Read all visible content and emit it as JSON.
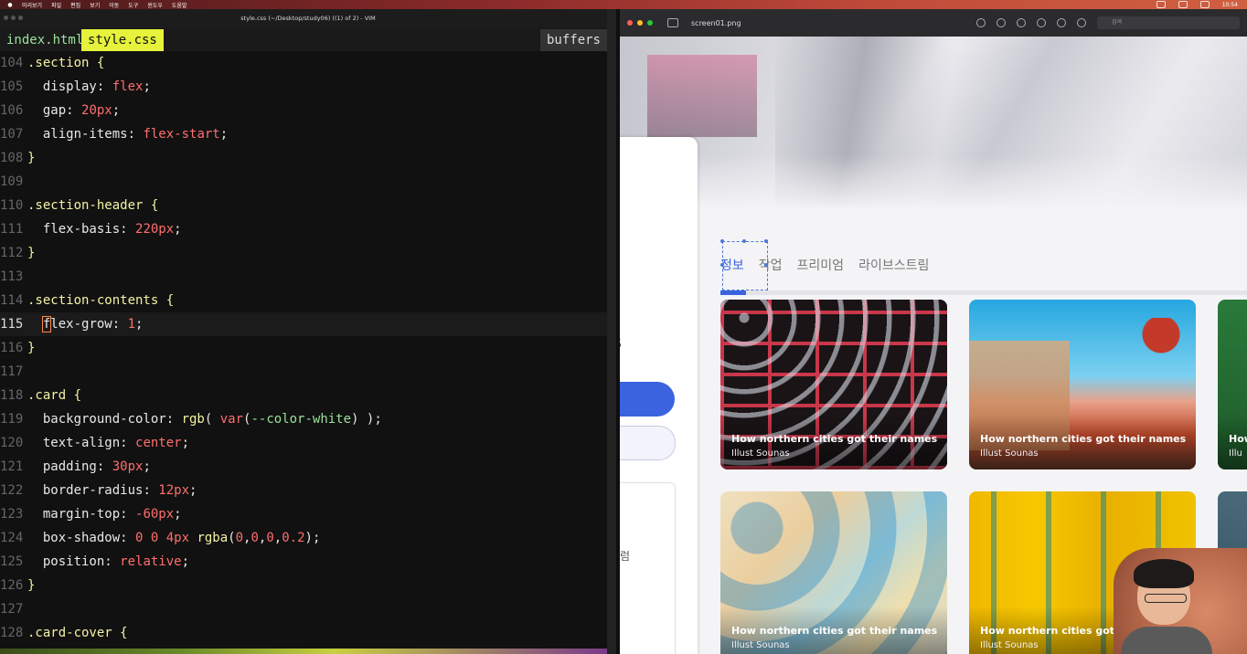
{
  "menubar": {
    "items": [
      "미리보기",
      "파일",
      "편집",
      "보기",
      "이동",
      "도구",
      "윈도우",
      "도움말"
    ],
    "clock": "10:54"
  },
  "vim": {
    "window_title": "style.css (~/Desktop/study06) ((1) of 2) - VIM",
    "tabs": [
      "index.html",
      "style.css"
    ],
    "buffers_label": "buffers",
    "lines": [
      {
        "n": "104",
        "tokens": [
          [
            "sel",
            ".section {"
          ]
        ]
      },
      {
        "n": "105",
        "tokens": [
          [
            "prop",
            "  display"
          ],
          [
            "punct",
            ": "
          ],
          [
            "val",
            "flex"
          ],
          [
            "punct",
            ";"
          ]
        ]
      },
      {
        "n": "106",
        "tokens": [
          [
            "prop",
            "  gap"
          ],
          [
            "punct",
            ": "
          ],
          [
            "num",
            "20px"
          ],
          [
            "punct",
            ";"
          ]
        ]
      },
      {
        "n": "107",
        "tokens": [
          [
            "prop",
            "  align-items"
          ],
          [
            "punct",
            ": "
          ],
          [
            "val",
            "flex-start"
          ],
          [
            "punct",
            ";"
          ]
        ]
      },
      {
        "n": "108",
        "tokens": [
          [
            "sel",
            "}"
          ]
        ]
      },
      {
        "n": "109",
        "tokens": []
      },
      {
        "n": "110",
        "tokens": [
          [
            "sel",
            ".section-header {"
          ]
        ]
      },
      {
        "n": "111",
        "tokens": [
          [
            "prop",
            "  flex-basis"
          ],
          [
            "punct",
            ": "
          ],
          [
            "num",
            "220px"
          ],
          [
            "punct",
            ";"
          ]
        ]
      },
      {
        "n": "112",
        "tokens": [
          [
            "sel",
            "}"
          ]
        ]
      },
      {
        "n": "113",
        "tokens": []
      },
      {
        "n": "114",
        "tokens": [
          [
            "sel",
            ".section-contents {"
          ]
        ]
      },
      {
        "n": "115",
        "tokens": [
          [
            "prop",
            "  flex-grow"
          ],
          [
            "punct",
            ": "
          ],
          [
            "num",
            "1"
          ],
          [
            "punct",
            ";"
          ]
        ],
        "cursor": true
      },
      {
        "n": "116",
        "tokens": [
          [
            "sel",
            "}"
          ]
        ]
      },
      {
        "n": "117",
        "tokens": []
      },
      {
        "n": "118",
        "tokens": [
          [
            "sel",
            ".card {"
          ]
        ]
      },
      {
        "n": "119",
        "tokens": [
          [
            "prop",
            "  background-color"
          ],
          [
            "punct",
            ": "
          ],
          [
            "fn",
            "rgb"
          ],
          [
            "punct",
            "( "
          ],
          [
            "val",
            "var"
          ],
          [
            "punct",
            "("
          ],
          [
            "var",
            "--color-white"
          ],
          [
            "punct",
            ") );"
          ]
        ]
      },
      {
        "n": "120",
        "tokens": [
          [
            "prop",
            "  text-align"
          ],
          [
            "punct",
            ": "
          ],
          [
            "val",
            "center"
          ],
          [
            "punct",
            ";"
          ]
        ]
      },
      {
        "n": "121",
        "tokens": [
          [
            "prop",
            "  padding"
          ],
          [
            "punct",
            ": "
          ],
          [
            "num",
            "30px"
          ],
          [
            "punct",
            ";"
          ]
        ]
      },
      {
        "n": "122",
        "tokens": [
          [
            "prop",
            "  border-radius"
          ],
          [
            "punct",
            ": "
          ],
          [
            "num",
            "12px"
          ],
          [
            "punct",
            ";"
          ]
        ]
      },
      {
        "n": "123",
        "tokens": [
          [
            "prop",
            "  margin-top"
          ],
          [
            "punct",
            ": "
          ],
          [
            "num",
            "-60px"
          ],
          [
            "punct",
            ";"
          ]
        ]
      },
      {
        "n": "124",
        "tokens": [
          [
            "prop",
            "  box-shadow"
          ],
          [
            "punct",
            ": "
          ],
          [
            "num",
            "0 0 4px "
          ],
          [
            "fn",
            "rgba"
          ],
          [
            "punct",
            "("
          ],
          [
            "num",
            "0"
          ],
          [
            "punct",
            ","
          ],
          [
            "num",
            "0"
          ],
          [
            "punct",
            ","
          ],
          [
            "num",
            "0"
          ],
          [
            "punct",
            ","
          ],
          [
            "num",
            "0.2"
          ],
          [
            "punct",
            ");"
          ]
        ]
      },
      {
        "n": "125",
        "tokens": [
          [
            "prop",
            "  position"
          ],
          [
            "punct",
            ": "
          ],
          [
            "val",
            "relative"
          ],
          [
            "punct",
            ";"
          ]
        ]
      },
      {
        "n": "126",
        "tokens": [
          [
            "sel",
            "}"
          ]
        ]
      },
      {
        "n": "127",
        "tokens": []
      },
      {
        "n": "128",
        "tokens": [
          [
            "sel",
            ".card-cover {"
          ]
        ]
      }
    ]
  },
  "preview": {
    "file_name": "screen01.png",
    "search_placeholder": "검색",
    "side_letter": "s",
    "side_korean": "럼",
    "tabs": [
      "정보",
      "작업",
      "프리미엄",
      "라이브스트림"
    ],
    "active_tab_index": 0,
    "cards": [
      {
        "title": "How northern cities got their names",
        "author": "Illust Sounas"
      },
      {
        "title": "How northern cities got their names",
        "author": "Illust Sounas"
      },
      {
        "title": "How",
        "author": "Illu"
      },
      {
        "title": "How northern cities got their names",
        "author": "Illust Sounas"
      },
      {
        "title": "How northern cities got the",
        "author": "Illust Sounas"
      },
      {
        "title": "",
        "author": ""
      }
    ]
  },
  "colors": {
    "accent_blue": "#3b63e0",
    "vim_active_tab": "#e6f23b",
    "vim_string": "#ff6e6e",
    "vim_selector": "#f3f3a5",
    "vim_var": "#9be29b"
  }
}
